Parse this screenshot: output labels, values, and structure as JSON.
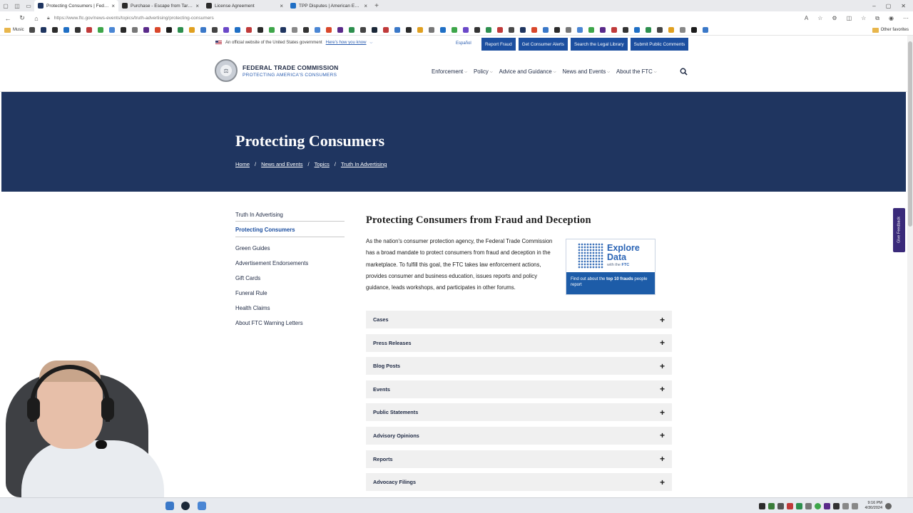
{
  "browser": {
    "tabs": [
      {
        "title": "Protecting Consumers | Federal Trade Commission",
        "active": true,
        "favicon_color": "#1f3560"
      },
      {
        "title": "Purchase - Escape from Tarkov",
        "active": false,
        "favicon_color": "#2b2b2b"
      },
      {
        "title": "License Agreement",
        "active": false,
        "favicon_color": "#2b2b2b"
      },
      {
        "title": "TPP Disputes | American Express",
        "active": false,
        "favicon_color": "#1f6fc5"
      }
    ],
    "url": "https://www.ftc.gov/news-events/topics/truth-advertising/protecting-consumers",
    "bookmarks_folder": "Music",
    "other_bookmarks": "Other favorites"
  },
  "site": {
    "gov_banner": "An official website of the United States government",
    "gov_link": "Here's how you know",
    "espanol": "Español",
    "util_buttons": [
      "Report Fraud",
      "Get Consumer Alerts",
      "Search the Legal Library",
      "Submit Public Comments"
    ],
    "brand_name": "FEDERAL TRADE COMMISSION",
    "brand_sub": "PROTECTING AMERICA'S CONSUMERS",
    "nav": [
      "Enforcement",
      "Policy",
      "Advice and Guidance",
      "News and Events",
      "About the FTC"
    ]
  },
  "hero": {
    "title": "Protecting Consumers",
    "breadcrumbs": [
      "Home",
      "News and Events",
      "Topics",
      "Truth In Advertising"
    ]
  },
  "sidenav": {
    "items": [
      "Truth In Advertising",
      "Protecting Consumers",
      "Green Guides",
      "Advertisement Endorsements",
      "Gift Cards",
      "Funeral Rule",
      "Health Claims",
      "About FTC Warning Letters"
    ]
  },
  "content": {
    "title": "Protecting Consumers from Fraud and Deception",
    "intro": "As the nation's consumer protection agency, the Federal Trade Commission has a broad mandate to protect consumers from fraud and deception in the marketplace. To fulfill this goal, the FTC takes law enforcement actions, provides consumer and business education, issues reports and policy guidance, leads workshops, and participates in other forums.",
    "explore": {
      "line1": "Explore",
      "line2": "Data",
      "with": "with the",
      "ftc": "FTC",
      "bar_pre": "Find out about the ",
      "bar_bold": "top 10 frauds",
      "bar_post": " people report"
    },
    "accordion": [
      "Cases",
      "Press Releases",
      "Blog Posts",
      "Events",
      "Public Statements",
      "Advisory Opinions",
      "Reports",
      "Advocacy Filings"
    ]
  },
  "feedback_label": "Give Feedback",
  "taskbar": {
    "time": "9:16 PM",
    "date": "4/30/2024"
  }
}
